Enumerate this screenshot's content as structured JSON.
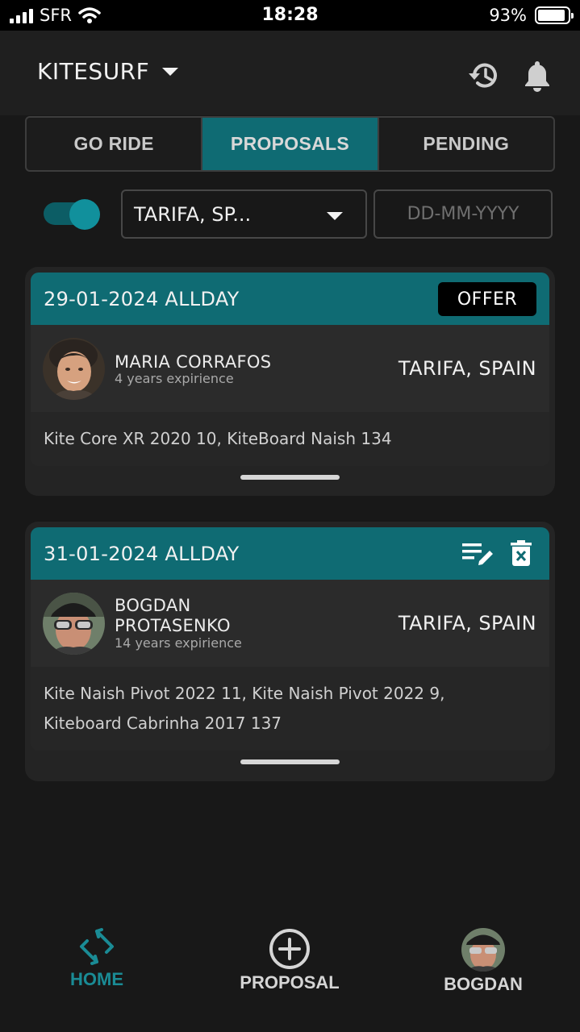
{
  "status_bar": {
    "carrier": "SFR",
    "time": "18:28",
    "battery": "93%",
    "battery_level": 0.93
  },
  "header": {
    "sport": "KITESURF",
    "history_icon": "history-icon",
    "notifications_icon": "bell-icon"
  },
  "tabs": [
    {
      "label": "GO RIDE",
      "active": false
    },
    {
      "label": "PROPOSALS",
      "active": true
    },
    {
      "label": "PENDING",
      "active": false
    }
  ],
  "filters": {
    "toggle_on": true,
    "location": "TARIFA, SP...",
    "date_placeholder": "DD-MM-YYYY"
  },
  "cards": [
    {
      "date": "29-01-2024 ALLDAY",
      "action": "OFFER",
      "name": "MARIA CORRAFOS",
      "experience": "4 years expirience",
      "location": "TARIFA, SPAIN",
      "equipment": "Kite Core XR 2020 10, KiteBoard Naish 134"
    },
    {
      "date": "31-01-2024 ALLDAY",
      "name_line1": "BOGDAN",
      "name_line2": "PROTASENKO",
      "experience": "14 years expirience",
      "location": "TARIFA, SPAIN",
      "equipment_line1": "Kite Naish Pivot 2022 11, Kite Naish Pivot 2022 9,",
      "equipment_line2": "Kiteboard Cabrinha 2017 137"
    }
  ],
  "bottom_nav": [
    {
      "label": "HOME",
      "active": true,
      "color": "#1a8b95"
    },
    {
      "label": "PROPOSAL",
      "active": false,
      "color": "#d5d5d5"
    },
    {
      "label": "BOGDAN",
      "active": false,
      "color": "#d5d5d5"
    }
  ],
  "colors": {
    "accent": "#0f6b73",
    "background": "#181818"
  }
}
